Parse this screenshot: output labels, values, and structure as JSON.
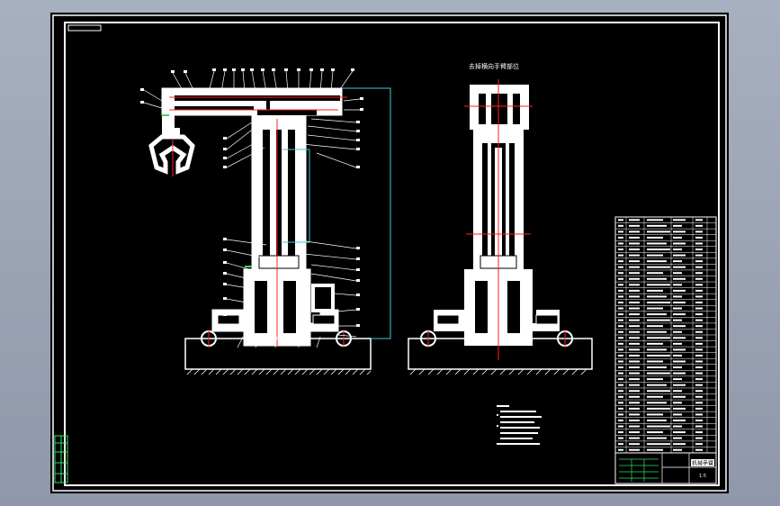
{
  "drawing": {
    "view_title": "去掉横向手臂部位",
    "title_block": {
      "name_cell": "机械手臂",
      "scale_cell": "1:5"
    }
  },
  "colors": {
    "background_outer": "#9aa3b4",
    "sheet": "#000000",
    "line_white": "#ffffff",
    "line_red": "#ff2020",
    "line_cyan": "#40c8d8",
    "line_green": "#30e060"
  }
}
